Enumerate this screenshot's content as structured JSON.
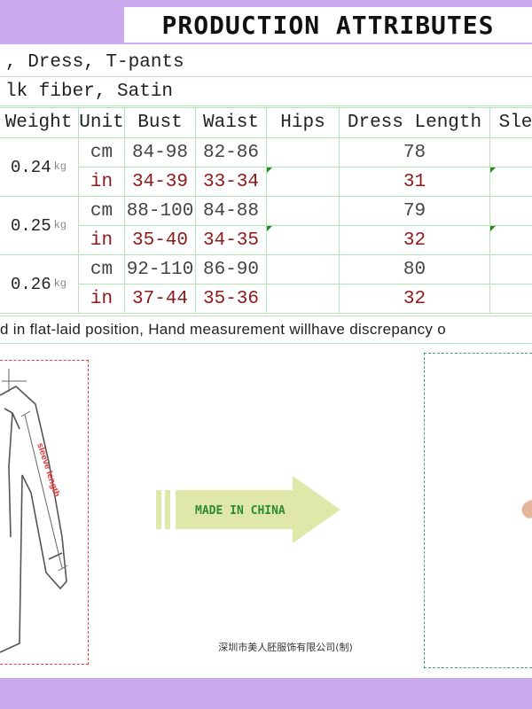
{
  "title": "PRODUCTION ATTRIBUTES",
  "attributes": [
    ", Dress, T-pants",
    "lk fiber, Satin"
  ],
  "table": {
    "headers": [
      "Weight",
      "Unit",
      "Bust",
      "Waist",
      "Hips",
      "Dress Length",
      "Sle"
    ],
    "weight_unit": "kg",
    "sizes": [
      {
        "weight": "0.24",
        "cm": {
          "unit": "cm",
          "bust": "84-98",
          "waist": "82-86",
          "hips": "",
          "dress_length": "78"
        },
        "in": {
          "unit": "in",
          "bust": "34-39",
          "waist": "33-34",
          "hips": "",
          "dress_length": "31"
        }
      },
      {
        "weight": "0.25",
        "cm": {
          "unit": "cm",
          "bust": "88-100",
          "waist": "84-88",
          "hips": "",
          "dress_length": "79"
        },
        "in": {
          "unit": "in",
          "bust": "35-40",
          "waist": "34-35",
          "hips": "",
          "dress_length": "32"
        }
      },
      {
        "weight": "0.26",
        "cm": {
          "unit": "cm",
          "bust": "92-110",
          "waist": "86-90",
          "hips": "",
          "dress_length": "80"
        },
        "in": {
          "unit": "in",
          "bust": "37-44",
          "waist": "35-36",
          "hips": "",
          "dress_length": "32"
        }
      }
    ]
  },
  "note": "d in flat-laid position, Hand measurement willhave discrepancy o",
  "diagram": {
    "sleeve_label": "sleeve length"
  },
  "arrow": {
    "label": "MADE IN CHINA"
  },
  "company": "深圳市美人胚服饰有限公司(制)",
  "colors": {
    "band": "#cbaaf0",
    "grid": "#b6e3b6",
    "inch_text": "#8b1a1a",
    "arrow_fill": "#dfe8a9",
    "arrow_text": "#2f8a2f"
  }
}
